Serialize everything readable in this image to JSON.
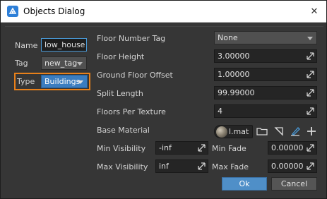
{
  "window": {
    "title": "Objects Dialog",
    "close_glyph": "✕"
  },
  "left": {
    "name_label": "Name",
    "name_value": "low_house",
    "tag_label": "Tag",
    "tag_value": "new_tag",
    "type_label": "Type",
    "type_value": "Buildings"
  },
  "right": {
    "floor_number_tag_label": "Floor Number Tag",
    "floor_number_tag_value": "None",
    "floor_height_label": "Floor Height",
    "floor_height_value": "3.00000",
    "ground_floor_offset_label": "Ground Floor Offset",
    "ground_floor_offset_value": "1.00000",
    "split_length_label": "Split Length",
    "split_length_value": "99.99000",
    "floors_per_texture_label": "Floors Per Texture",
    "floors_per_texture_value": "4",
    "base_material_label": "Base Material",
    "base_material_value": "l.mat",
    "min_visibility_label": "Min Visibility",
    "min_visibility_value": "-inf",
    "max_visibility_label": "Max Visibility",
    "max_visibility_value": "inf",
    "min_fade_label": "Min Fade",
    "min_fade_value": "0.00000",
    "max_fade_label": "Max Fade",
    "max_fade_value": "0.00000"
  },
  "buttons": {
    "ok_label": "Ok",
    "cancel_label": "Cancel"
  },
  "colors": {
    "accent": "#3b7dc0",
    "highlight": "#e8801a",
    "background": "#363636"
  },
  "icons": {
    "app": "app-logo-icon",
    "spin": "drag-spin-icon",
    "folder": "folder-icon",
    "clear": "clear-icon",
    "edit": "edit-icon",
    "add": "plus-icon",
    "close": "close-icon"
  }
}
